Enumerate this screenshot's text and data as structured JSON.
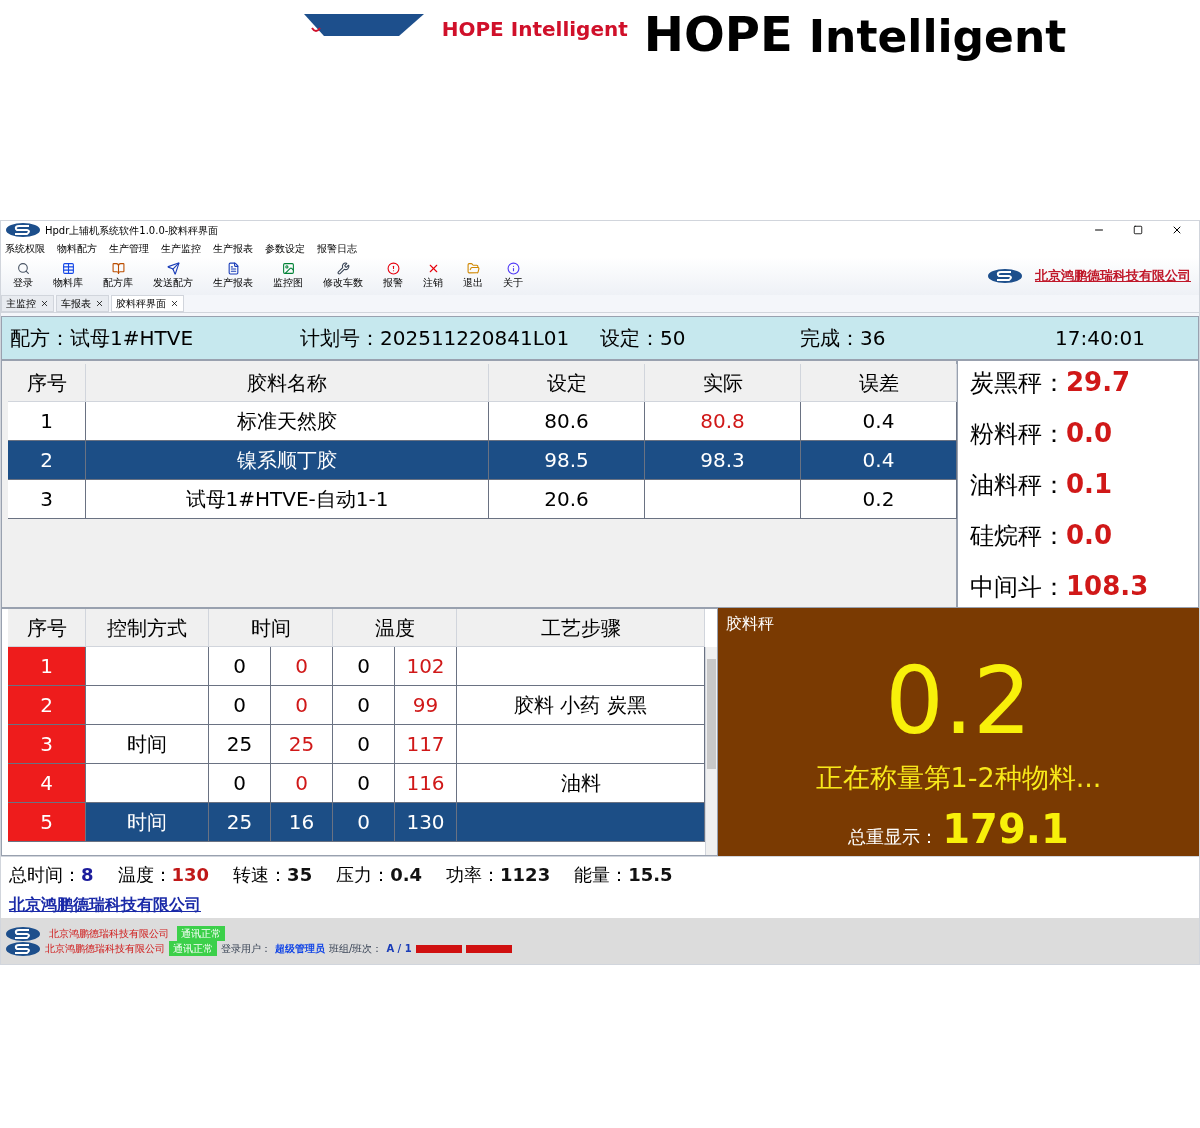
{
  "logo": {
    "small_text": "HOPE Intelligent",
    "big_text": [
      "HOPE",
      "Intelligent"
    ]
  },
  "window": {
    "title": "Hpdr上辅机系统软件1.0.0-胶料秤界面",
    "menu": [
      "系统权限",
      "物料配方",
      "生产管理",
      "生产监控",
      "生产报表",
      "参数设定",
      "报警日志"
    ],
    "toolbar": [
      {
        "label": "登录",
        "kind": "search"
      },
      {
        "label": "物料库",
        "kind": "table"
      },
      {
        "label": "配方库",
        "kind": "book"
      },
      {
        "label": "发送配方",
        "kind": "send"
      },
      {
        "label": "生产报表",
        "kind": "report"
      },
      {
        "label": "监控图",
        "kind": "image"
      },
      {
        "label": "修改车数",
        "kind": "wrench"
      },
      {
        "label": "报警",
        "kind": "alarm"
      },
      {
        "label": "注销",
        "kind": "cancel"
      },
      {
        "label": "退出",
        "kind": "exit"
      },
      {
        "label": "关于",
        "kind": "info"
      }
    ],
    "company": "北京鸿鹏德瑞科技有限公司",
    "tabs": [
      {
        "label": "主监控",
        "selected": false
      },
      {
        "label": "车报表",
        "selected": false
      },
      {
        "label": "胶料秤界面",
        "selected": true
      }
    ]
  },
  "info": [
    {
      "label": "配方：",
      "value": "试母1#HTVE"
    },
    {
      "label": "计划号：",
      "value": "202511220841L01"
    },
    {
      "label": "设定：",
      "value": "50"
    },
    {
      "label": "完成：",
      "value": "36"
    },
    {
      "value": "17:40:01"
    }
  ],
  "weigh_table": {
    "columns": [
      "序号",
      "胶料名称",
      "设定",
      "实际",
      "误差"
    ],
    "rows": [
      {
        "cells": [
          "1",
          "标准天然胶",
          "80.6",
          "80.8",
          "0.4"
        ],
        "selected": false
      },
      {
        "cells": [
          "2",
          "镍系顺丁胶",
          "98.5",
          "98.3",
          "0.4"
        ],
        "selected": true
      },
      {
        "cells": [
          "3",
          "试母1#HTVE-自动1-1",
          "20.6",
          "",
          "0.2"
        ],
        "selected": false
      }
    ]
  },
  "scales": [
    {
      "label": "炭黑秤：",
      "value": "29.7"
    },
    {
      "label": "粉料秤：",
      "value": "0.0"
    },
    {
      "label": "油料秤：",
      "value": "0.1"
    },
    {
      "label": "硅烷秤：",
      "value": "0.0"
    },
    {
      "label": "中间斗：",
      "value": "108.3"
    }
  ],
  "process_table": {
    "columns": [
      "序号",
      "控制方式",
      "时间",
      "温度",
      "工艺步骤"
    ],
    "rows": [
      {
        "seq": "1",
        "time": [
          "0",
          "0"
        ],
        "temp": [
          "0",
          "102"
        ],
        "selected": false
      },
      {
        "seq": "2",
        "time": [
          "0",
          "0"
        ],
        "temp": [
          "0",
          "99"
        ],
        "step": "胶料 小药 炭黑",
        "selected": false
      },
      {
        "seq": "3",
        "mode": "时间",
        "time": [
          "25",
          "25"
        ],
        "temp": [
          "0",
          "117"
        ],
        "selected": false
      },
      {
        "seq": "4",
        "time": [
          "0",
          "0"
        ],
        "temp": [
          "0",
          "116"
        ],
        "step": "油料",
        "selected": false
      },
      {
        "seq": "5",
        "mode": "时间",
        "time": [
          "25",
          "16"
        ],
        "temp": [
          "0",
          "130"
        ],
        "selected": true
      }
    ]
  },
  "rubber_scale": {
    "title": "胶料秤",
    "value": "0.2",
    "status": "正在称量第1-2种物料...",
    "total_label": "总重显示：",
    "total": "179.1"
  },
  "stats": [
    {
      "label": "总时间：",
      "value": "8",
      "color": "#1c1c9c"
    },
    {
      "label": "温度：",
      "value": "130",
      "color": "#c01818"
    },
    {
      "label": "转速：",
      "value": "35",
      "color": "#111111"
    },
    {
      "label": "压力：",
      "value": "0.4",
      "color": "#111111"
    },
    {
      "label": "功率：",
      "value": "1123",
      "color": "#111111"
    },
    {
      "label": "能量：",
      "value": "15.5",
      "color": "#111111"
    }
  ],
  "footer_link": "北京鸿鹏德瑞科技有限公司",
  "status1": {
    "company": "北京鸿鹏德瑞科技有限公司",
    "comm": "通讯正常"
  },
  "status2": {
    "company": "北京鸿鹏德瑞科技有限公司",
    "comm": "通讯正常",
    "user_label": "登录用户：",
    "user": "超级管理员",
    "shift_label": "班组/班次：",
    "shift": "A / 1"
  }
}
